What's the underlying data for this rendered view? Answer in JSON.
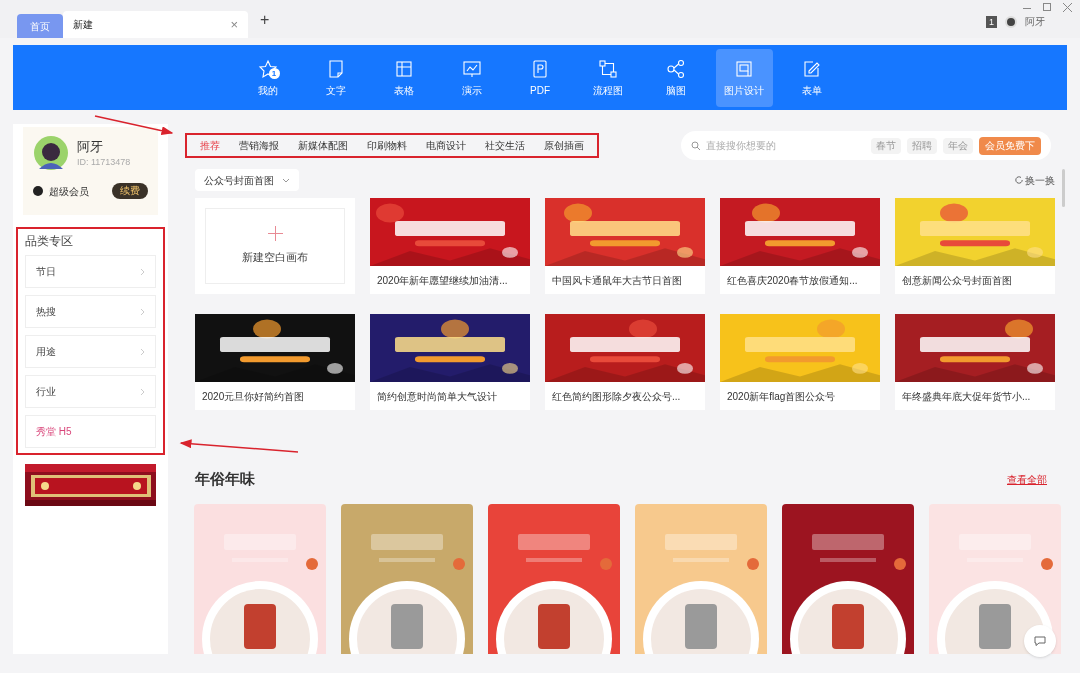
{
  "window_tabs": [
    {
      "label": "首页",
      "kind": "home",
      "selected": false
    },
    {
      "label": "新建",
      "kind": "doc",
      "selected": true,
      "close": "×"
    }
  ],
  "new_tab": "+",
  "user_badge": "1",
  "user_name": "阿牙",
  "nav": [
    {
      "label": "我的",
      "selected": false,
      "badge": "1"
    },
    {
      "label": "文字",
      "selected": false
    },
    {
      "label": "表格",
      "selected": false
    },
    {
      "label": "演示",
      "selected": false
    },
    {
      "label": "PDF",
      "selected": false
    },
    {
      "label": "流程图",
      "selected": false
    },
    {
      "label": "脑图",
      "selected": false
    },
    {
      "label": "图片设计",
      "selected": true
    },
    {
      "label": "表单",
      "selected": false
    }
  ],
  "profile": {
    "name": "阿牙",
    "id": "ID: 11713478",
    "member": "超级会员",
    "renew": "续费"
  },
  "category_zone": {
    "title": "品类专区",
    "items": [
      {
        "label": "节日",
        "kind": "arrow"
      },
      {
        "label": "热搜",
        "kind": "arrow"
      },
      {
        "label": "用途",
        "kind": "arrow"
      },
      {
        "label": "行业",
        "kind": "arrow"
      },
      {
        "label": "秀堂 H5",
        "kind": "link"
      }
    ]
  },
  "category_tabs": [
    {
      "label": "推荐",
      "selected": true
    },
    {
      "label": "营销海报",
      "selected": false
    },
    {
      "label": "新媒体配图",
      "selected": false
    },
    {
      "label": "印刷物料",
      "selected": false
    },
    {
      "label": "电商设计",
      "selected": false
    },
    {
      "label": "社交生活",
      "selected": false
    },
    {
      "label": "原创插画",
      "selected": false
    }
  ],
  "search": {
    "placeholder": "直接搜你想要的",
    "tags": [
      "春节",
      "招聘",
      "年会"
    ],
    "button": "会员免费下"
  },
  "filter": "公众号封面首图",
  "refresh": "换一换",
  "new_canvas": "新建空白画布",
  "templates": [
    "2020年新年愿望继续加油清...",
    "中国风卡通鼠年大吉节日首图",
    "红色喜庆2020春节放假通知...",
    "创意新闻公众号封面首图",
    "2020元旦你好简约首图",
    "简约创意时尚简单大气设计",
    "红色简约图形除夕夜公众号...",
    "2020新年flag首图公众号",
    "年终盛典年底大促年货节小..."
  ],
  "section": {
    "title": "年俗年味",
    "more": "查看全部"
  }
}
